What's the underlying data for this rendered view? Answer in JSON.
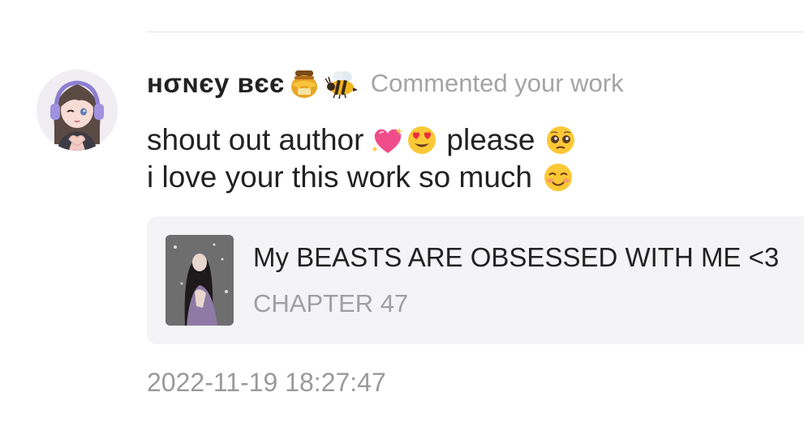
{
  "comment_item": {
    "user": {
      "name": "ʜσɴєу вєє",
      "name_emoji_icons": [
        "honey-pot-icon",
        "bee-icon"
      ]
    },
    "activity_text": "Commented your work",
    "comment": {
      "line1_before": "shout out author",
      "line1_emojis": [
        "sparkling-heart-icon",
        "heart-eyes-icon"
      ],
      "line1_after": "please",
      "line1_end_emoji": "pleading-face-icon",
      "line2": "i love your this work so much",
      "line2_end_emoji": "smiling-blush-face-icon"
    },
    "work": {
      "title": "My BEASTS ARE OBSESSED WITH ME <3",
      "chapter": "CHAPTER 47"
    },
    "timestamp": "2022-11-19 18:27:47"
  },
  "colors": {
    "text_primary": "#222222",
    "text_secondary": "#a4a4a4",
    "card_background": "#f4f4f6",
    "divider": "#e4e4e4"
  }
}
